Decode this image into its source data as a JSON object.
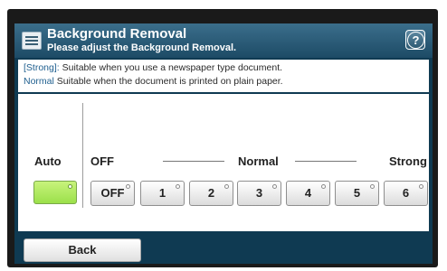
{
  "header": {
    "title": "Background Removal",
    "subtitle": "Please adjust the Background Removal.",
    "help_label": "?"
  },
  "description": {
    "strong_key": "[Strong]:",
    "strong_text": "Suitable when you use a newspaper type document.",
    "normal_key": "Normal",
    "normal_text": "Suitable when the document is printed on plain paper."
  },
  "scale": {
    "auto_label": "Auto",
    "off_label": "OFF",
    "normal_label": "Normal",
    "strong_label": "Strong"
  },
  "auto_button": {
    "selected": true
  },
  "levels": [
    "OFF",
    "1",
    "2",
    "3",
    "4",
    "5",
    "6"
  ],
  "footer": {
    "back_label": "Back"
  },
  "colors": {
    "panel": "#0f3a52",
    "header": "#2c5a75",
    "selected_green": "#b4ea63"
  }
}
